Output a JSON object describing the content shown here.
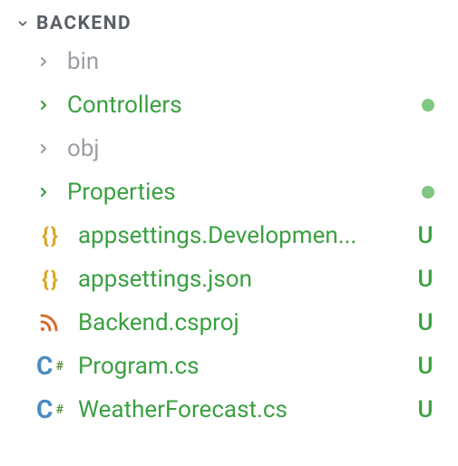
{
  "root": {
    "label": "BACKEND",
    "expanded": true
  },
  "items": [
    {
      "type": "folder",
      "label": "bin",
      "color": "muted",
      "status": null
    },
    {
      "type": "folder",
      "label": "Controllers",
      "color": "green",
      "status": "dot"
    },
    {
      "type": "folder",
      "label": "obj",
      "color": "muted",
      "status": null
    },
    {
      "type": "folder",
      "label": "Properties",
      "color": "green",
      "status": "dot"
    },
    {
      "type": "file",
      "label": "appsettings.Developmen...",
      "icon": "json",
      "color": "green",
      "status": "U"
    },
    {
      "type": "file",
      "label": "appsettings.json",
      "icon": "json",
      "color": "green",
      "status": "U"
    },
    {
      "type": "file",
      "label": "Backend.csproj",
      "icon": "rss",
      "color": "green",
      "status": "U"
    },
    {
      "type": "file",
      "label": "Program.cs",
      "icon": "csharp",
      "color": "green",
      "status": "U"
    },
    {
      "type": "file",
      "label": "WeatherForecast.cs",
      "icon": "csharp",
      "color": "green",
      "status": "U"
    }
  ]
}
